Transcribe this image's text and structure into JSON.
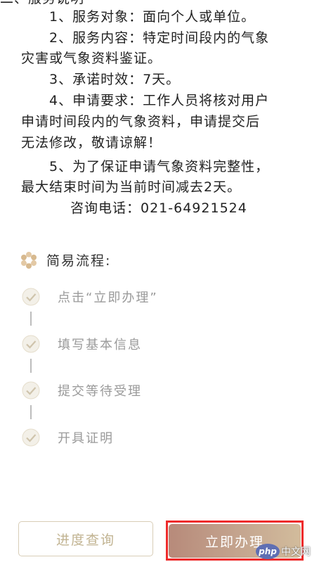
{
  "notice": {
    "lines": [
      "二、服务说明",
      "1、服务对象：面向个人或单位。",
      "2、服务内容：特定时间段内的气象",
      "灾害或气象资料鉴证。",
      "3、承诺时效：7天。",
      "4、申请要求：工作人员将核对用户",
      "申请时间段内的气象资料，申请提交后",
      "无法修改，敬请谅解！",
      "5、为了保证申请气象资料完整性，",
      "最大结束时间为当前时间减去2天。",
      "咨询电话：021-64921524"
    ]
  },
  "flow": {
    "title": "简易流程:",
    "icon": "flower-icon",
    "steps": [
      {
        "label": "点击“立即办理”",
        "icon": "check-circle-icon"
      },
      {
        "label": "填写基本信息",
        "icon": "check-circle-icon"
      },
      {
        "label": "提交等待受理",
        "icon": "check-circle-icon"
      },
      {
        "label": "开具证明",
        "icon": "check-circle-icon"
      }
    ]
  },
  "buttons": {
    "query_label": "进度查询",
    "apply_label": "立即办理"
  },
  "watermark": {
    "logo": "php",
    "text": "中文网"
  },
  "colors": {
    "accent_gold": "#c1b391",
    "apply_gradient_start": "#b78a7a",
    "apply_gradient_end": "#d2bc9c",
    "highlight_red": "#ee2b2b",
    "step_gray": "#9a9a9a"
  }
}
